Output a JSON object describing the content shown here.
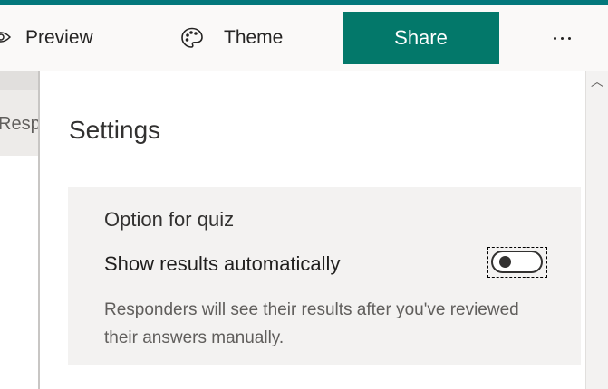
{
  "toolbar": {
    "preview_label": "Preview",
    "theme_label": "Theme",
    "share_label": "Share",
    "more_label": "More options",
    "icons": {
      "preview": "eye-icon",
      "theme": "palette-icon",
      "more": "ellipsis-icon"
    },
    "colors": {
      "accent_stripe": "#03787c",
      "share_button": "#03786a"
    }
  },
  "left_panel": {
    "tab_label": "Resp"
  },
  "settings": {
    "title": "Settings",
    "quiz": {
      "heading": "Option for quiz",
      "option_label": "Show results automatically",
      "toggle_on": false,
      "description": "Responders will see their results after you've reviewed their answers manually."
    }
  },
  "scrollbar": {
    "up_icon": "chevron-up-icon",
    "up_glyph": "︿"
  }
}
